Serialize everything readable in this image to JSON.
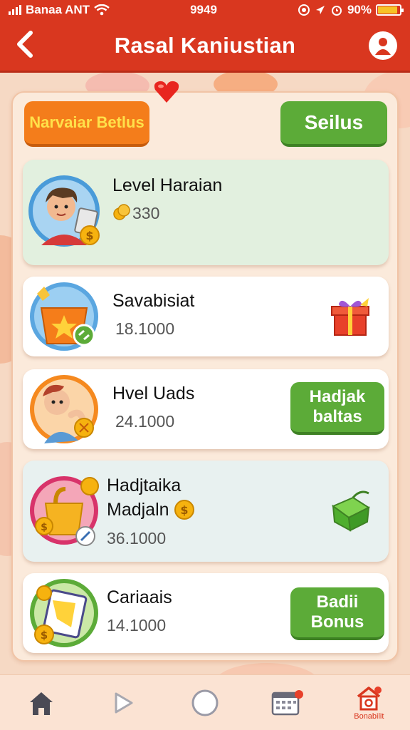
{
  "status_bar": {
    "carrier": "Banaa ANT",
    "time": "9949",
    "battery": "90%",
    "battery_level": 0.9
  },
  "header": {
    "title": "Rasal Kaniustian",
    "back_icon": "chevron-left-icon",
    "profile_icon": "user-icon"
  },
  "top_buttons": {
    "left_label": "Narvaiar Betlus",
    "right_label": "Seilus"
  },
  "cards": [
    {
      "title": "Level Haraian",
      "value": "330",
      "icon": "boy-avatar-icon"
    },
    {
      "title": "Savabisiat",
      "value": "18.1000",
      "icon": "gift-box-icon"
    },
    {
      "title": "Hvel Uads",
      "value": "24.1000",
      "button_label": "Hadjak baltas",
      "icon": "baby-avatar-icon"
    },
    {
      "title": "Hadjtaika Madjaln",
      "value": "36.1000",
      "icon": "gift-box-green-icon"
    },
    {
      "title": "Cariaais",
      "value": "14.1000",
      "button_label": "Badii Bonus",
      "icon": "coupon-icon"
    }
  ],
  "bottom_nav": {
    "items": [
      {
        "name": "home",
        "icon": "home-icon",
        "label": ""
      },
      {
        "name": "play",
        "icon": "play-icon",
        "label": ""
      },
      {
        "name": "circle",
        "icon": "circle-icon",
        "label": ""
      },
      {
        "name": "calendar",
        "icon": "calendar-icon",
        "label": ""
      },
      {
        "name": "bonus",
        "icon": "house-bonus-icon",
        "label": "Bonabilit"
      }
    ]
  },
  "colors": {
    "header": "#d9371f",
    "accent_orange": "#f47d1b",
    "accent_green": "#5cab38",
    "background": "#f6d9c4"
  }
}
